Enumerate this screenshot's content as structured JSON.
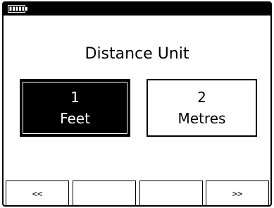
{
  "status_bar": {
    "battery_icon": "battery-icon",
    "battery_level": 1.0
  },
  "title": "Distance Unit",
  "options": [
    {
      "number": "1",
      "label": "Feet",
      "selected": true
    },
    {
      "number": "2",
      "label": "Metres",
      "selected": false
    }
  ],
  "softkeys": [
    "<<",
    "",
    "",
    ">>"
  ],
  "colors": {
    "foreground": "#000000",
    "background": "#ffffff"
  }
}
